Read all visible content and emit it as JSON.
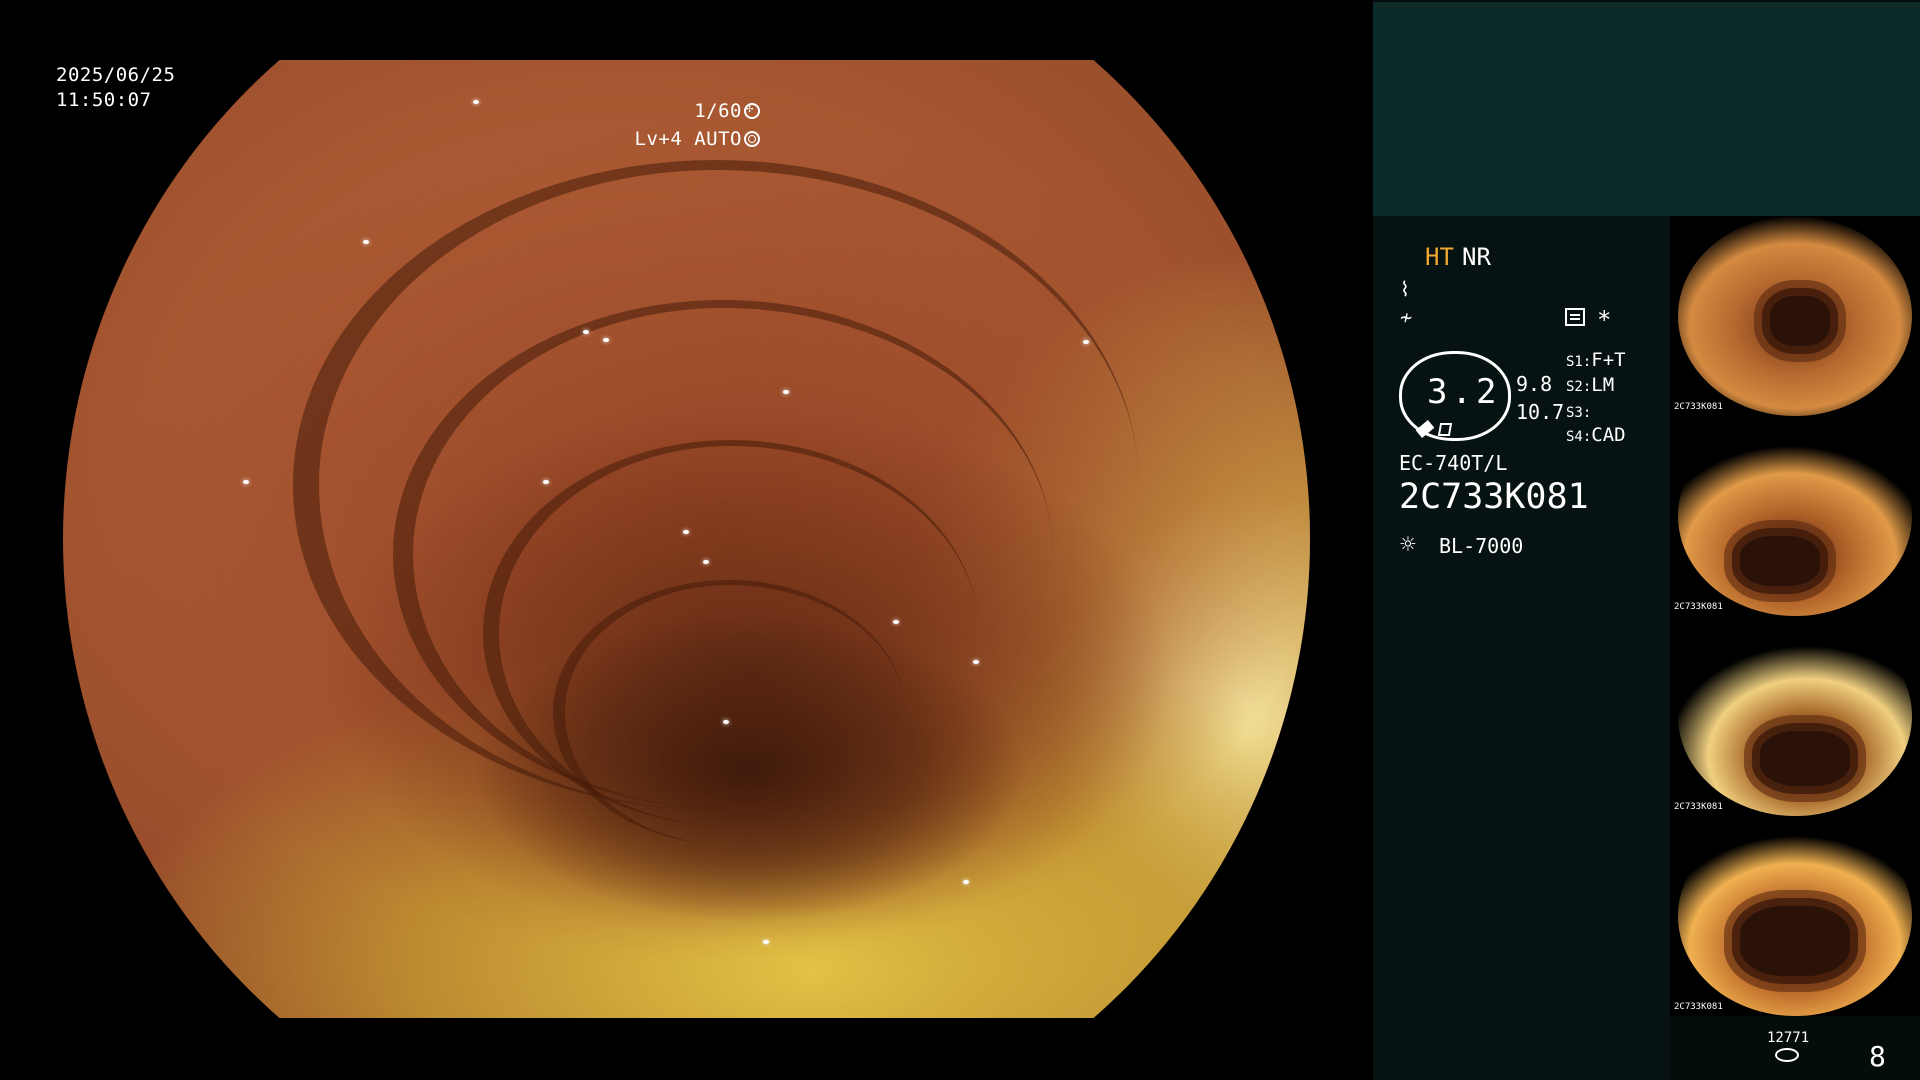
{
  "overlay": {
    "date": "2025/06/25",
    "time": "11:50:07",
    "shutter": "1/60",
    "level": "Lv+4 AUTO"
  },
  "panel": {
    "mode_ht": "HT",
    "mode_nr": "NR",
    "zoom_value": "3.2",
    "value_top": "9.8",
    "value_bottom": "10.7",
    "asterisk": "*",
    "settings": [
      {
        "label": "S1:",
        "value": "F+T"
      },
      {
        "label": "S2:",
        "value": "LM"
      },
      {
        "label": "S3:",
        "value": ""
      },
      {
        "label": "S4:",
        "value": "CAD"
      }
    ],
    "scope_model": "EC-740T/L",
    "serial_number": "2C733K081",
    "light_source": "BL-7000",
    "thumb_label": "2C733K081",
    "counter_small": "12771",
    "counter_big": "8"
  },
  "colors": {
    "ht_accent": "#f0a830",
    "panel_top": "#0c2a27",
    "panel_bg": "#071312"
  },
  "icons": [
    "shutter-icon",
    "iris-icon",
    "wave-icon",
    "settings-icon",
    "light-source-icon",
    "pencil-icon",
    "database-icon"
  ]
}
